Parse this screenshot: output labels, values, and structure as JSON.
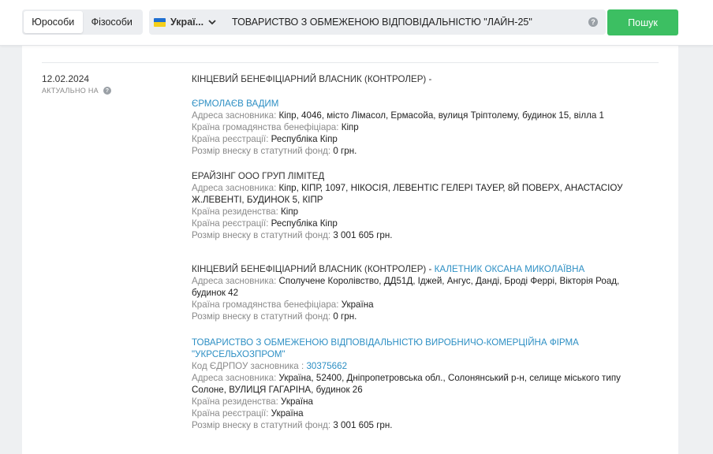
{
  "header": {
    "tabs": [
      "Юрособи",
      "Фізособи"
    ],
    "country": "Украї...",
    "search_value": "ТОВАРИСТВО З ОБМЕЖЕНОЮ ВІДПОВІДАЛЬНІСТЮ \"ЛАЙН-25\"",
    "help": "?",
    "search_button": "Пошук"
  },
  "entry": {
    "date": "12.02.2024",
    "actual_label": "АКТУАЛЬНО НА",
    "help": "?",
    "owner_heading": "КІНЦЕВИЙ БЕНЕФІЦІАРНИЙ ВЛАСНИК (КОНТРОЛЕР) -",
    "owner_heading_2": "КІНЦЕВИЙ БЕНЕФІЦІАРНИЙ ВЛАСНИК (КОНТРОЛЕР) -",
    "owner_2_name": "КАЛЕТНИК ОКСАНА МИКОЛАЇВНА",
    "person_1": {
      "name": "ЄРМОЛАЄВ ВАДИМ",
      "address_label": "Адреса засновника:",
      "address": "Кіпр, 4046, місто Лімасол, Ермасойа, вулиця Тріптолему, будинок 15, вілла 1",
      "citizenship_label": "Країна громадянства бенефіціара:",
      "citizenship": "Кіпр",
      "registration_label": "Країна реєстрації:",
      "registration": "Республіка Кіпр",
      "contribution_label": "Розмір внеску в статутний фонд:",
      "contribution": "0 грн."
    },
    "company_1": {
      "name": "ЕРАЙЗІНГ ООО ГРУП ЛІМІТЕД",
      "address_label": "Адреса засновника:",
      "address_line1": "Кіпр, КІПР, 1097, НІКОСІЯ, ЛЕВЕНТІС ГЕЛЕРІ ТАУЕР, 8Й ПОВЕРХ, АНАСТАСІОУ",
      "address_line2": "Ж.ЛЕВЕНТІ, БУДИНОК 5, КІПР",
      "residence_label": "Країна резиденства:",
      "residence": "Кіпр",
      "registration_label": "Країна реєстрації:",
      "registration": "Республіка Кіпр",
      "contribution_label": "Розмір внеску в статутний фонд:",
      "contribution": "3 001 605 грн."
    },
    "person_2": {
      "address_label": "Адреса засновника:",
      "address_line1": "Сполучене Королівство, ДД51Д, Іджей, Ангус, Данді, Броді Феррі, Вікторія Роад,",
      "address_line2": "будинок 42",
      "citizenship_label": "Країна громадянства бенефіціара:",
      "citizenship": "Україна",
      "contribution_label": "Розмір внеску в статутний фонд:",
      "contribution": "0 грн."
    },
    "company_2": {
      "name_line1": "ТОВАРИСТВО З ОБМЕЖЕНОЮ ВІДПОВІДАЛЬНІСТЮ ВИРОБНИЧО-КОМЕРЦІЙНА ФІРМА",
      "name_line2": "\"УКРСЕЛЬХОЗПРОМ\"",
      "code_label": "Код ЄДРПОУ засновника :",
      "code": "30375662",
      "address_label": "Адреса засновника:",
      "address_line1": "Україна, 52400, Дніпропетровська обл., Солонянський р-н, селище міського типу",
      "address_line2": "Солоне, ВУЛИЦЯ ГАГАРІНА, будинок 26",
      "residence_label": "Країна резиденства:",
      "residence": "Україна",
      "registration_label": "Країна реєстрації:",
      "registration": "Україна",
      "contribution_label": "Розмір внеску в статутний фонд:",
      "contribution": "3 001 605 грн."
    }
  },
  "colors": {
    "accent": "#3cbf62",
    "link": "#2d8fc4",
    "flag_blue": "#1f6fd1",
    "flag_yellow": "#f5cf1b"
  },
  "icons": [
    "chevron-down-icon",
    "help-icon",
    "ukraine-flag-icon"
  ]
}
